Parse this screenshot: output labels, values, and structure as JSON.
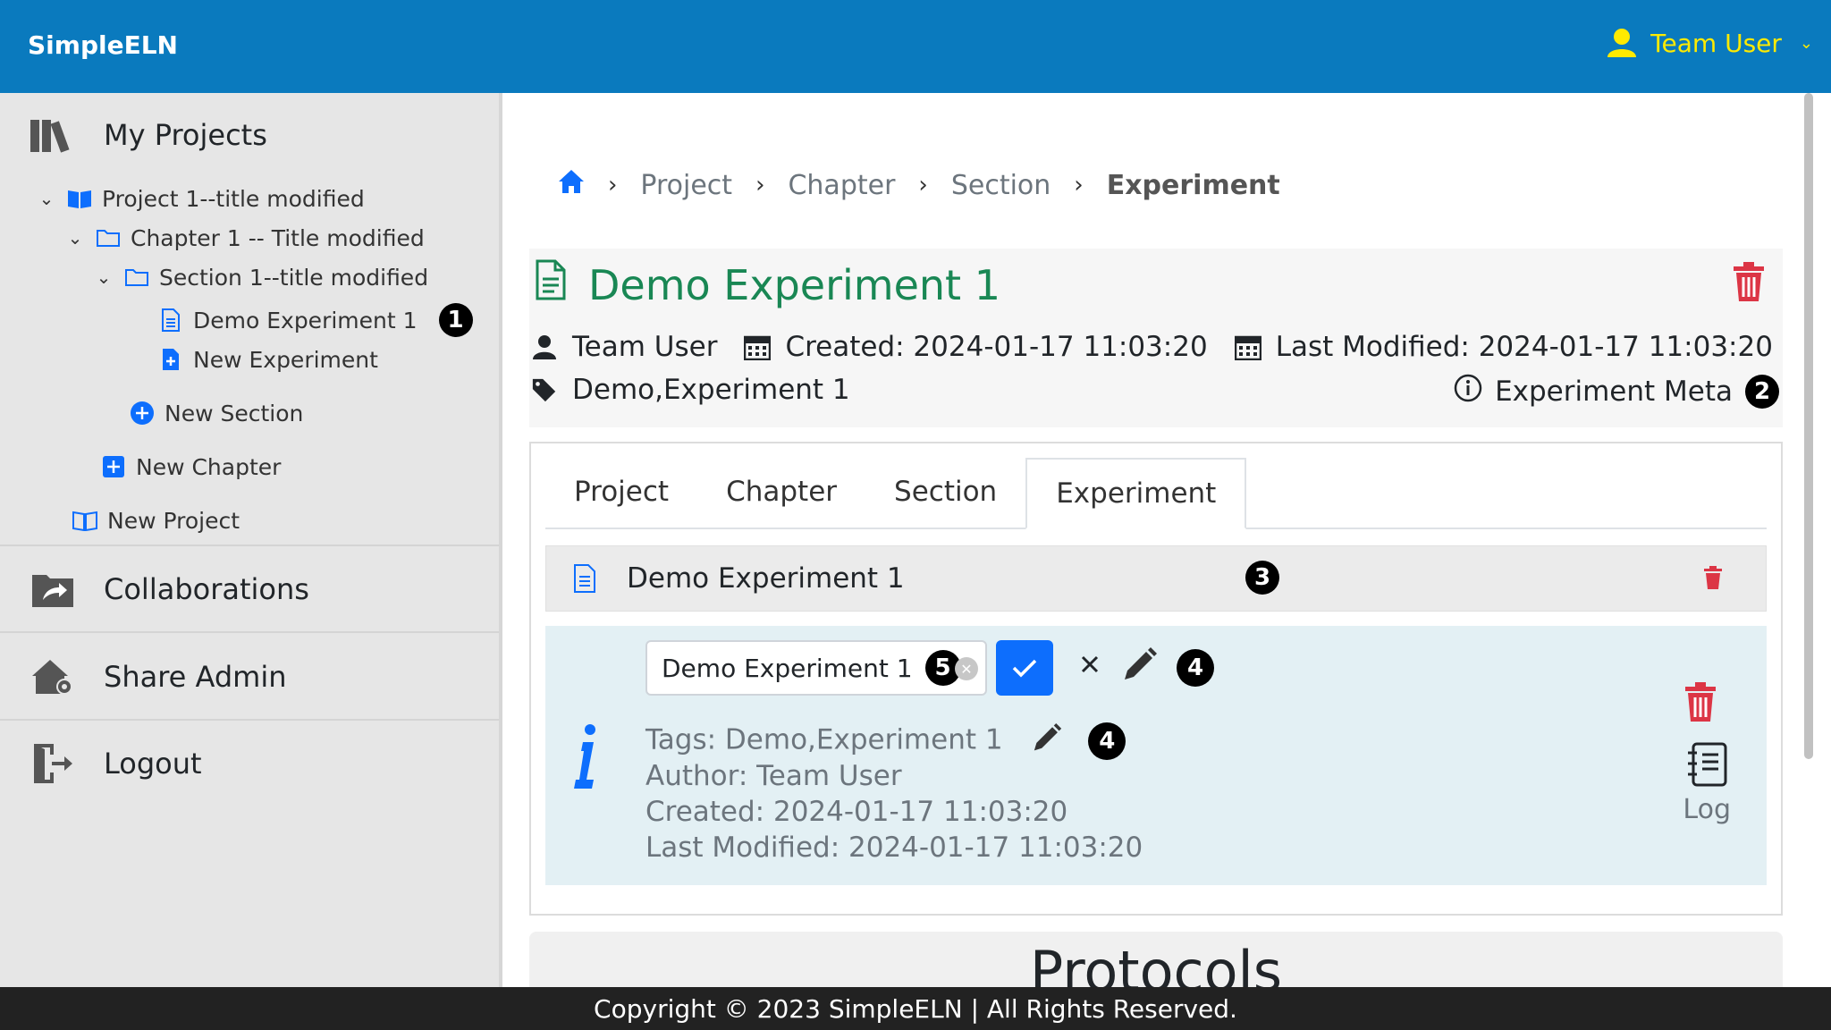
{
  "app": {
    "brand": "SimpleELN",
    "user": "Team User"
  },
  "sidebar": {
    "my_projects": "My Projects",
    "tree": {
      "project": "Project 1--title modified",
      "chapter": "Chapter 1 -- Title modified",
      "section": "Section 1--title modified",
      "experiment": "Demo Experiment 1",
      "new_experiment": "New Experiment",
      "new_section": "New Section",
      "new_chapter": "New Chapter",
      "new_project": "New Project"
    },
    "collaborations": "Collaborations",
    "share_admin": "Share Admin",
    "logout": "Logout"
  },
  "breadcrumb": [
    "Project",
    "Chapter",
    "Section",
    "Experiment"
  ],
  "experiment": {
    "title": "Demo Experiment 1",
    "author": "Team User",
    "created": "Created: 2024-01-17 11:03:20",
    "modified": "Last Modified: 2024-01-17 11:03:20",
    "tags": "Demo,Experiment 1",
    "meta_link": "Experiment Meta"
  },
  "tabs": [
    "Project",
    "Chapter",
    "Section",
    "Experiment"
  ],
  "active_tab": "Experiment",
  "item": {
    "title": "Demo Experiment 1",
    "edit_value": "Demo Experiment 1",
    "tags_line": "Tags: Demo,Experiment 1",
    "author_line": "Author:  Team User",
    "created_line": "Created:  2024-01-17 11:03:20",
    "modified_line": "Last Modified:  2024-01-17 11:03:20",
    "log_label": "Log"
  },
  "annotations": [
    "1",
    "2",
    "3",
    "4",
    "5"
  ],
  "protocols_heading": "Protocols",
  "footer": "Copyright © 2023 SimpleELN | All Rights Reserved.",
  "colors": {
    "topbar": "#0a7abe",
    "user": "#ffea00",
    "title_green": "#198754",
    "primary": "#0d6efd",
    "danger": "#dc3545"
  }
}
